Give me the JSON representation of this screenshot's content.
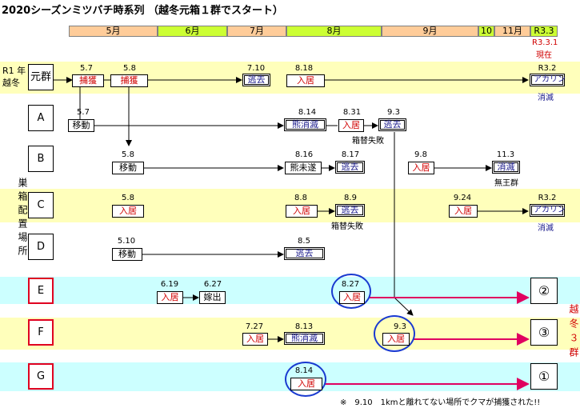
{
  "title": "2020シーズンミツバチ時系列 （越冬元箱１群でスタート）",
  "months": [
    {
      "label": "5月",
      "color": "#ffcc99"
    },
    {
      "label": "6月",
      "color": "#ccff33"
    },
    {
      "label": "7月",
      "color": "#ffcc99"
    },
    {
      "label": "8月",
      "color": "#ccff33"
    },
    {
      "label": "9月",
      "color": "#ffcc99"
    },
    {
      "label": "10",
      "color": "#ccff33"
    },
    {
      "label": "11月",
      "color": "#ffcc99"
    },
    {
      "label": "R3.3",
      "color": "#ccff33"
    }
  ],
  "left_labels": {
    "r1": "R1 年",
    "r1b": "越冬",
    "vertical": "巣箱配置場所"
  },
  "right_label": "越冬３群",
  "header_note": {
    "line1": "R3.3.1",
    "line2": "現在"
  },
  "rows": {
    "genpai": "元群",
    "A": "A",
    "B": "B",
    "C": "C",
    "D": "D",
    "E": "E",
    "F": "F",
    "G": "G"
  },
  "events": {
    "g1_date": "5.7",
    "g1_label": "捕獲",
    "g2_date": "5.8",
    "g2_label": "捕獲",
    "g3_date": "7.10",
    "g3_label": "逃去",
    "g4_date": "8.18",
    "g4_label": "入居",
    "g5_date": "R3.2",
    "g5_label": "アカリン",
    "g5_note": "消滅",
    "a1_date": "5.7",
    "a1_label": "移動",
    "a2_date": "8.14",
    "a2_label": "熊消滅",
    "a3_date": "8.31",
    "a3_label": "入居",
    "a4_date": "9.3",
    "a4_label": "逃去",
    "a4_note": "箱替失敗",
    "b1_date": "5.8",
    "b1_label": "移動",
    "b2_date": "8.16",
    "b2_label": "熊未遂",
    "b3_date": "8.17",
    "b3_label": "逃去",
    "b4_date": "9.8",
    "b4_label": "入居",
    "b5_date": "11.3",
    "b5_label": "消滅",
    "b5_note": "無王群",
    "c1_date": "5.8",
    "c1_label": "入居",
    "c2_date": "8.8",
    "c2_label": "入居",
    "c3_date": "8.9",
    "c3_label": "逃去",
    "c3_note": "箱替失敗",
    "c4_date": "9.24",
    "c4_label": "入居",
    "c5_date": "R3.2",
    "c5_label": "アカリン",
    "c5_note": "消滅",
    "d1_date": "5.10",
    "d1_label": "移動",
    "d2_date": "8.5",
    "d2_label": "逃去",
    "e1_date": "6.19",
    "e1_label": "入居",
    "e2_date": "6.27",
    "e2_label": "嫁出",
    "e3_date": "8.27",
    "e3_label": "入居",
    "e_end": "②",
    "f1_date": "7.27",
    "f1_label": "入居",
    "f2_date": "8.13",
    "f2_label": "熊消滅",
    "f3_date": "9.3",
    "f3_label": "入居",
    "f_end": "③",
    "g_date": "8.14",
    "g_label": "入居",
    "g_end": "①"
  },
  "footnote": "※　9.10　1kmと離れてない場所でクマが捕獲された!!",
  "colors": {
    "yellow_band": "#ffffbb",
    "cyan_band": "#ccffff",
    "red": "#e00020",
    "blue": "#1a3ad0"
  }
}
